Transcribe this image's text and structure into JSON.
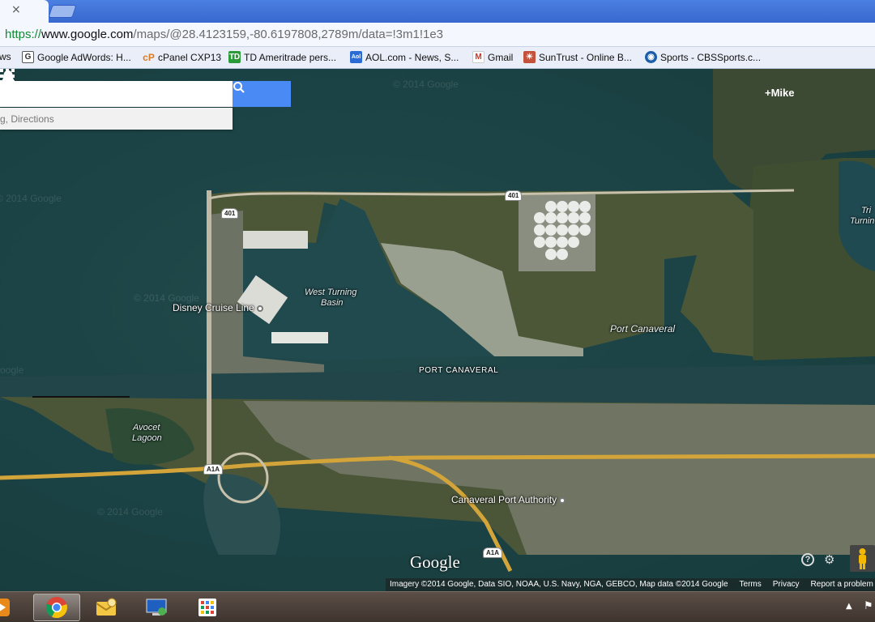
{
  "browser": {
    "tab_close_glyph": "×",
    "url": {
      "scheme": "https://",
      "host": "www.google.com",
      "path": "/maps/@28.4123159,-80.6197808,2789m/data=!3m1!1e3"
    },
    "bookmarks": [
      {
        "label": "ws",
        "icon": "partial-bookmark-icon"
      },
      {
        "label": "Google AdWords: H...",
        "icon": "google-adwords-icon"
      },
      {
        "label": "cPanel CXP13",
        "icon": "cpanel-icon"
      },
      {
        "label": "TD Ameritrade pers...",
        "icon": "td-ameritrade-icon"
      },
      {
        "label": "AOL.com - News, S...",
        "icon": "aol-icon"
      },
      {
        "label": "Gmail",
        "icon": "gmail-icon"
      },
      {
        "label": "SunTrust - Online B...",
        "icon": "suntrust-icon"
      },
      {
        "label": "Sports - CBSSports.c...",
        "icon": "cbs-eye-icon"
      }
    ]
  },
  "maps": {
    "search_placeholder": "",
    "search_hint": "g, Directions",
    "user_name": "+Mike",
    "labels": {
      "west_turning_basin_1": "West Turning",
      "west_turning_basin_2": "Basin",
      "disney_cruise_line": "Disney Cruise Line",
      "port_canaveral_caps": "PORT CANAVERAL",
      "port_canaveral": "Port Canaveral",
      "avocet_lagoon_1": "Avocet",
      "avocet_lagoon_2": "Lagoon",
      "canaveral_port_authority": "Canaveral Port Authority",
      "turning_partial_1": "Tri",
      "turning_partial_2": "Turnin"
    },
    "shields": {
      "route_401_a": "401",
      "route_401_b": "401",
      "route_a1a_a": "A1A",
      "route_a1a_b": "A1A"
    },
    "watermarks": {
      "w1": "© 2014 Google",
      "w2": "© 2014 Google",
      "w3": "© 2014 Google",
      "w4": "© 2014 Google",
      "w5": "oogle"
    },
    "google_logo": "Google",
    "help_glyph": "?",
    "settings_glyph": "⚙",
    "attribution": {
      "imagery": "Imagery ©2014 Google, Data SIO, NOAA, U.S. Navy, NGA, GEBCO, Map data ©2014 Google",
      "terms": "Terms",
      "privacy": "Privacy",
      "report": "Report a problem"
    }
  },
  "taskbar": {
    "apps": [
      {
        "name": "media-player-icon",
        "active": false
      },
      {
        "name": "chrome-icon",
        "active": true
      },
      {
        "name": "outlook-icon",
        "active": false
      },
      {
        "name": "remote-desktop-icon",
        "active": false
      },
      {
        "name": "app-grid-icon",
        "active": false
      }
    ],
    "tray_arrow_glyph": "▲",
    "tray_flag_glyph": "⚑"
  },
  "colors": {
    "water": "#1c4446",
    "land": "#47533a",
    "road_major": "#d3a43a",
    "search_blue": "#4a8af4",
    "chrome_blue": "#3868cf"
  }
}
